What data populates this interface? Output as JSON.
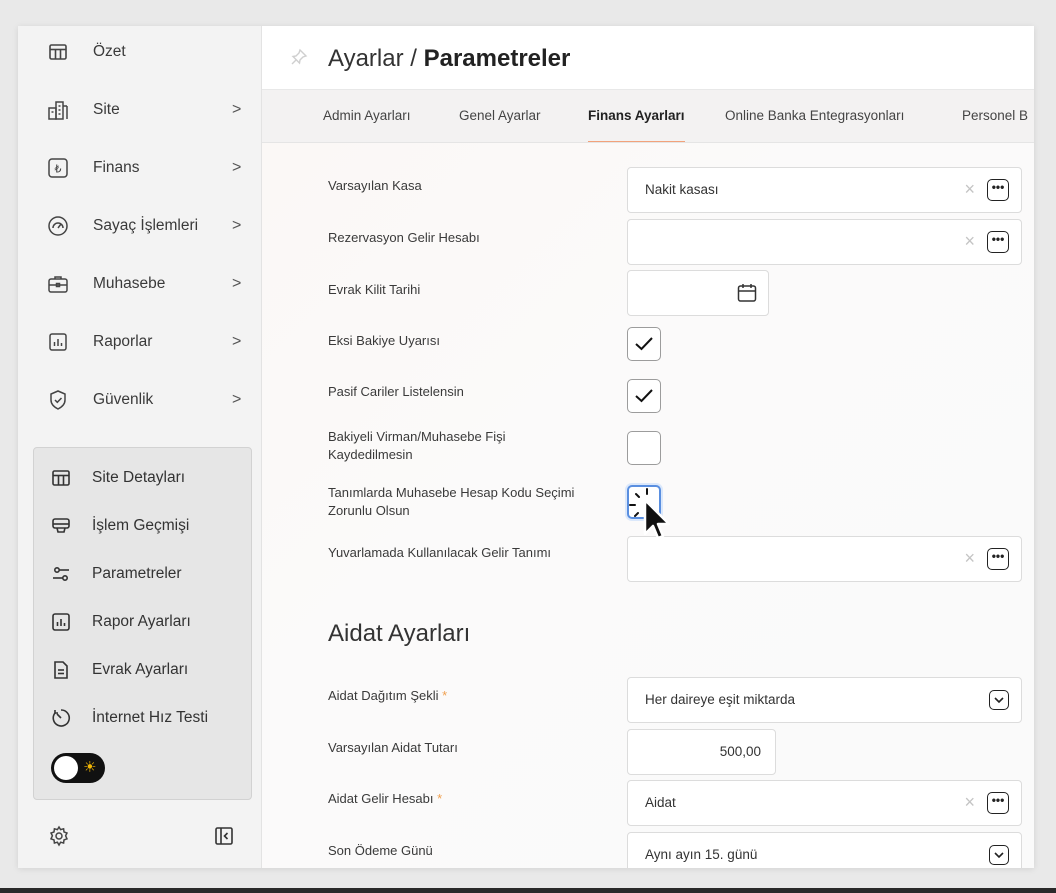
{
  "sidebar": {
    "items": [
      {
        "label": "Özet",
        "icon": "table-icon",
        "chevron": ""
      },
      {
        "label": "Site",
        "icon": "building-icon",
        "chevron": ">"
      },
      {
        "label": "Finans",
        "icon": "lira-icon",
        "chevron": ">"
      },
      {
        "label": "Sayaç İşlemleri",
        "icon": "gauge-icon",
        "chevron": ">"
      },
      {
        "label": "Muhasebe",
        "icon": "briefcase-icon",
        "chevron": ">"
      },
      {
        "label": "Raporlar",
        "icon": "report-icon",
        "chevron": ">"
      },
      {
        "label": "Güvenlik",
        "icon": "shield-icon",
        "chevron": ">"
      }
    ],
    "subitems": [
      {
        "label": "Site Detayları",
        "icon": "table-icon"
      },
      {
        "label": "İşlem Geçmişi",
        "icon": "monitor-icon"
      },
      {
        "label": "Parametreler",
        "icon": "sliders-icon"
      },
      {
        "label": "Rapor Ayarları",
        "icon": "report-icon"
      },
      {
        "label": "Evrak Ayarları",
        "icon": "document-icon"
      },
      {
        "label": "İnternet Hız Testi",
        "icon": "speed-icon"
      }
    ],
    "theme_toggle": {
      "icon": "sun-icon"
    },
    "footer": {
      "settings_icon": "gear-icon",
      "collapse_icon": "collapse-icon"
    }
  },
  "header": {
    "breadcrumb": "Ayarlar /",
    "current": "Parametreler",
    "pin_icon": "pin-icon"
  },
  "tabs": [
    {
      "label": "Admin Ayarları",
      "active": false
    },
    {
      "label": "Genel Ayarlar",
      "active": false
    },
    {
      "label": "Finans Ayarları",
      "active": true
    },
    {
      "label": "Online Banka Entegrasyonları",
      "active": false
    },
    {
      "label": "Personel B",
      "active": false
    }
  ],
  "form": {
    "varsayilan_kasa": {
      "label": "Varsayılan Kasa",
      "value": "Nakit kasası"
    },
    "rezervasyon": {
      "label": "Rezervasyon Gelir Hesabı",
      "value": ""
    },
    "evrak_kilit": {
      "label": "Evrak Kilit Tarihi",
      "value": ""
    },
    "eksi_bakiye": {
      "label": "Eksi Bakiye Uyarısı",
      "checked": true
    },
    "pasif_cariler": {
      "label": "Pasif Cariler Listelensin",
      "checked": true
    },
    "bakiyeli_virman": {
      "label_line1": "Bakiyeli Virman/Muhasebe Fişi",
      "label_line2": "Kaydedilmesin",
      "checked": false
    },
    "hesap_kodu": {
      "label_line1": "Tanımlarda Muhasebe Hesap Kodu Seçimi",
      "label_line2": "Zorunlu Olsun",
      "checked": false
    },
    "yuvarlama": {
      "label": "Yuvarlamada Kullanılacak Gelir Tanımı",
      "value": ""
    }
  },
  "aidat": {
    "section_title": "Aidat Ayarları",
    "dagitim": {
      "label": "Aidat Dağıtım Şekli",
      "required": "*",
      "value": "Her daireye eşit miktarda"
    },
    "tutar": {
      "label": "Varsayılan Aidat Tutarı",
      "value": "500,00"
    },
    "gelir_hesabi": {
      "label": "Aidat Gelir Hesabı",
      "required": "*",
      "value": "Aidat"
    },
    "son_odeme": {
      "label": "Son Ödeme Günü",
      "value": "Aynı ayın 15. günü"
    }
  },
  "controls": {
    "clear_symbol": "×",
    "more_symbol": "•••"
  },
  "colors": {
    "active_tab_underline": "#f2a27b",
    "required_star": "#f0a050",
    "focus_ring": "#5a8fe0"
  }
}
